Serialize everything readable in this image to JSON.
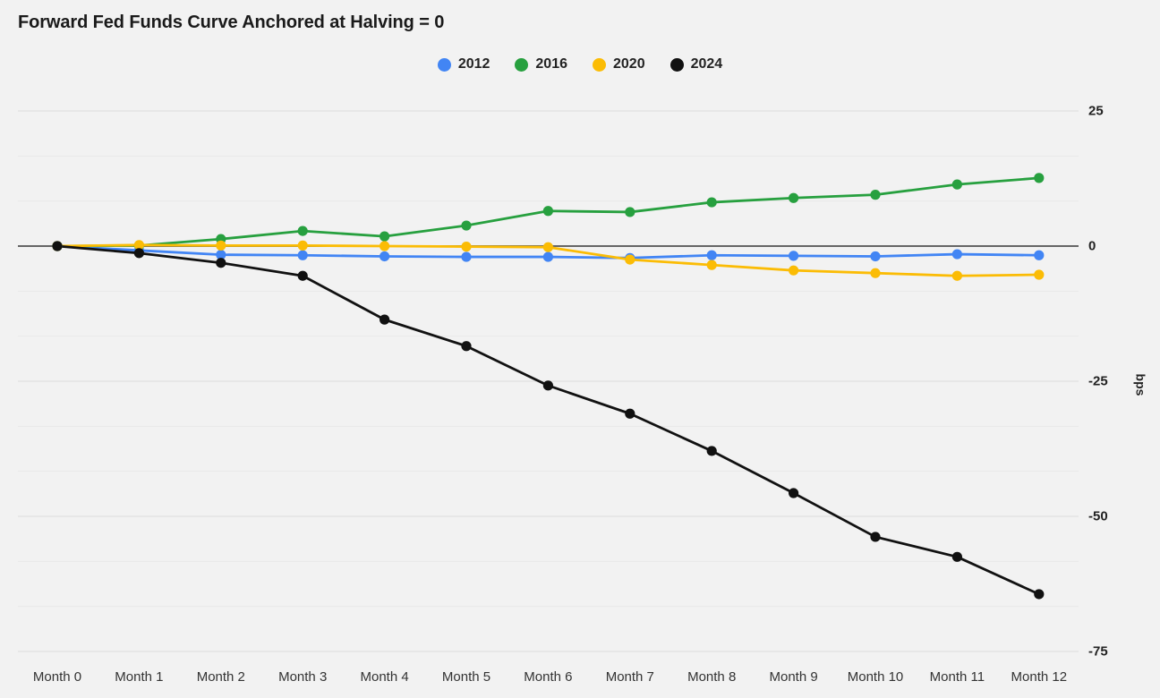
{
  "chart_data": {
    "type": "line",
    "title": "Forward Fed Funds Curve Anchored at Halving = 0",
    "xlabel": "",
    "ylabel": "bps",
    "categories": [
      "Month 0",
      "Month 1",
      "Month 2",
      "Month 3",
      "Month 4",
      "Month 5",
      "Month 6",
      "Month 7",
      "Month 8",
      "Month 9",
      "Month 10",
      "Month 11",
      "Month 12"
    ],
    "ylim": [
      -75,
      25
    ],
    "yticks": [
      25,
      0,
      -25,
      -50,
      -75
    ],
    "ytick_labels": [
      "25",
      "0",
      "-25",
      "-50",
      "-75"
    ],
    "minor_gridlines": true,
    "grid": true,
    "legend_position": "top-center",
    "zero_line": true,
    "series": [
      {
        "name": "2012",
        "color": "#4285f4",
        "values": [
          0,
          -0.8,
          -1.6,
          -1.7,
          -1.9,
          -2.0,
          -2.0,
          -2.2,
          -1.7,
          -1.8,
          -1.9,
          -1.5,
          -1.7
        ]
      },
      {
        "name": "2016",
        "color": "#27a03f",
        "values": [
          0,
          0.1,
          1.3,
          2.8,
          1.8,
          3.8,
          6.5,
          6.3,
          8.1,
          8.9,
          9.5,
          11.4,
          12.6
        ]
      },
      {
        "name": "2020",
        "color": "#fbbc05",
        "values": [
          0,
          0.2,
          0.1,
          0.1,
          0.0,
          -0.1,
          -0.2,
          -2.5,
          -3.5,
          -4.5,
          -5.0,
          -5.5,
          -5.3
        ]
      },
      {
        "name": "2024",
        "color": "#111111",
        "values": [
          0,
          -1.3,
          -3.1,
          -5.5,
          -13.6,
          -18.5,
          -25.8,
          -31.0,
          -37.9,
          -45.7,
          -53.8,
          -57.5,
          -64.4
        ]
      }
    ]
  },
  "legend": {
    "items": [
      {
        "label": "2012",
        "color": "#4285f4"
      },
      {
        "label": "2016",
        "color": "#27a03f"
      },
      {
        "label": "2020",
        "color": "#fbbc05"
      },
      {
        "label": "2024",
        "color": "#111111"
      }
    ]
  },
  "colors": {
    "background": "#f2f2f2",
    "gridline": "#e4e4e4",
    "zero_line": "#666666",
    "text": "#222222"
  }
}
